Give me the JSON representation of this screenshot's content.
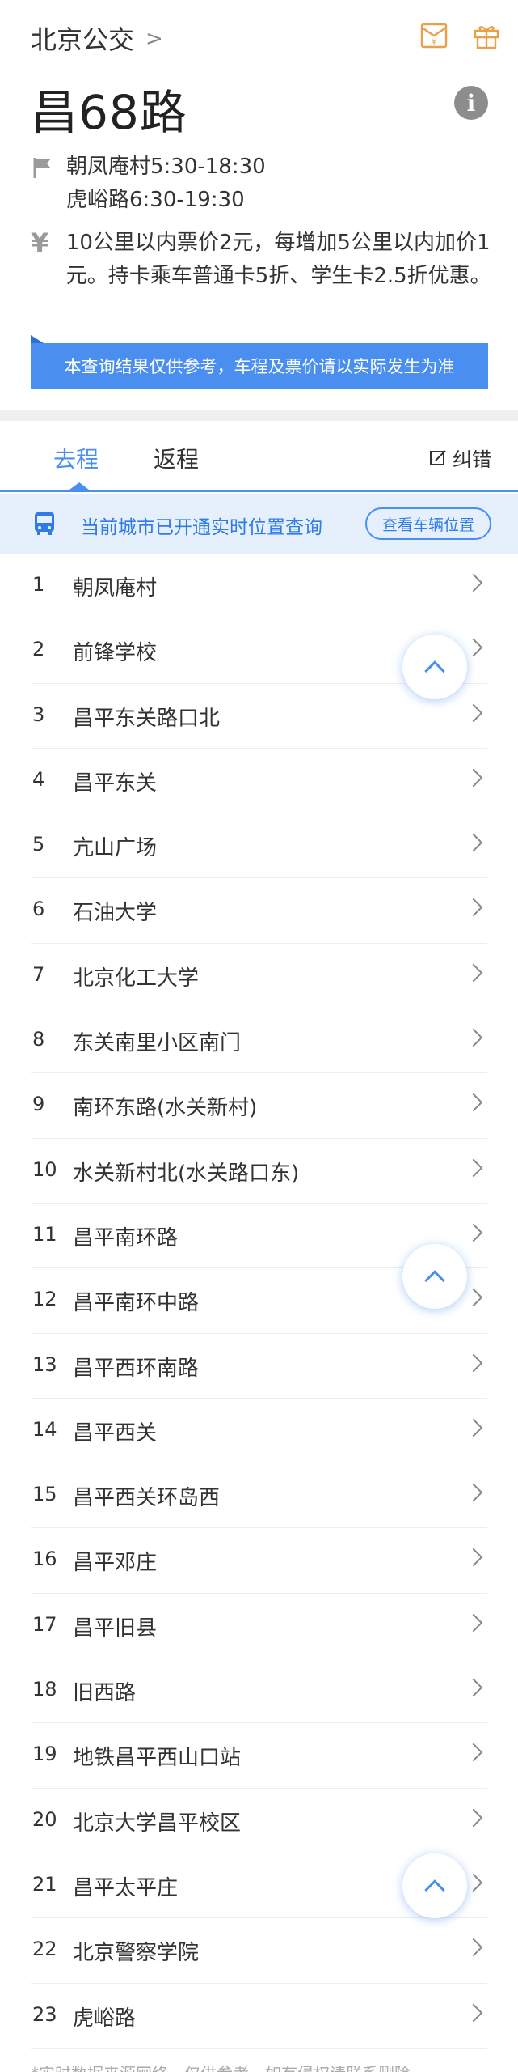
{
  "header": {
    "city": "北京公交",
    "city_chevron": ">",
    "route_name": "昌68路",
    "info_glyph": "i"
  },
  "route_info": {
    "time_lines": [
      "朝凤庵村5:30-18:30",
      "虎峪路6:30-19:30"
    ],
    "price_symbol": "¥",
    "price_text": "10公里以内票价2元，每增加5公里以内加价1元。持卡乘车普通卡5折、学生卡2.5折优惠。",
    "notice": "本查询结果仅供参考，车程及票价请以实际发生为准"
  },
  "tabs": {
    "forward": "去程",
    "return": "返程",
    "correct": "纠错"
  },
  "realtime": {
    "text": "当前城市已开通实时位置查询",
    "button": "查看车辆位置"
  },
  "stations": [
    {
      "num": "1",
      "name": "朝凤庵村"
    },
    {
      "num": "2",
      "name": "前锋学校"
    },
    {
      "num": "3",
      "name": "昌平东关路口北"
    },
    {
      "num": "4",
      "name": "昌平东关"
    },
    {
      "num": "5",
      "name": "亢山广场"
    },
    {
      "num": "6",
      "name": "石油大学"
    },
    {
      "num": "7",
      "name": "北京化工大学"
    },
    {
      "num": "8",
      "name": "东关南里小区南门"
    },
    {
      "num": "9",
      "name": "南环东路(水关新村)"
    },
    {
      "num": "10",
      "name": "水关新村北(水关路口东)"
    },
    {
      "num": "11",
      "name": "昌平南环路"
    },
    {
      "num": "12",
      "name": "昌平南环中路"
    },
    {
      "num": "13",
      "name": "昌平西环南路"
    },
    {
      "num": "14",
      "name": "昌平西关"
    },
    {
      "num": "15",
      "name": "昌平西关环岛西"
    },
    {
      "num": "16",
      "name": "昌平邓庄"
    },
    {
      "num": "17",
      "name": "昌平旧县"
    },
    {
      "num": "18",
      "name": "旧西路"
    },
    {
      "num": "19",
      "name": "地铁昌平西山口站"
    },
    {
      "num": "20",
      "name": "北京大学昌平校区"
    },
    {
      "num": "21",
      "name": "昌平太平庄"
    },
    {
      "num": "22",
      "name": "北京警察学院"
    },
    {
      "num": "23",
      "name": "虎峪路"
    }
  ],
  "footer": "*实时数据来源网络，仅供参考，如有侵权请联系删除",
  "colors": {
    "accent": "#4a8ef0",
    "orange_icons": "#e8a14a",
    "realtime_bg": "#e6f0fd"
  },
  "icons": {
    "city": "chevron-right",
    "header_left": "envelope-yuan-icon",
    "header_right": "gift-icon",
    "info": "info-icon",
    "time": "flag-icon",
    "price": "yuan-icon",
    "edit": "edit-icon",
    "bus": "bus-icon",
    "fab": "chevron-up-icon"
  }
}
